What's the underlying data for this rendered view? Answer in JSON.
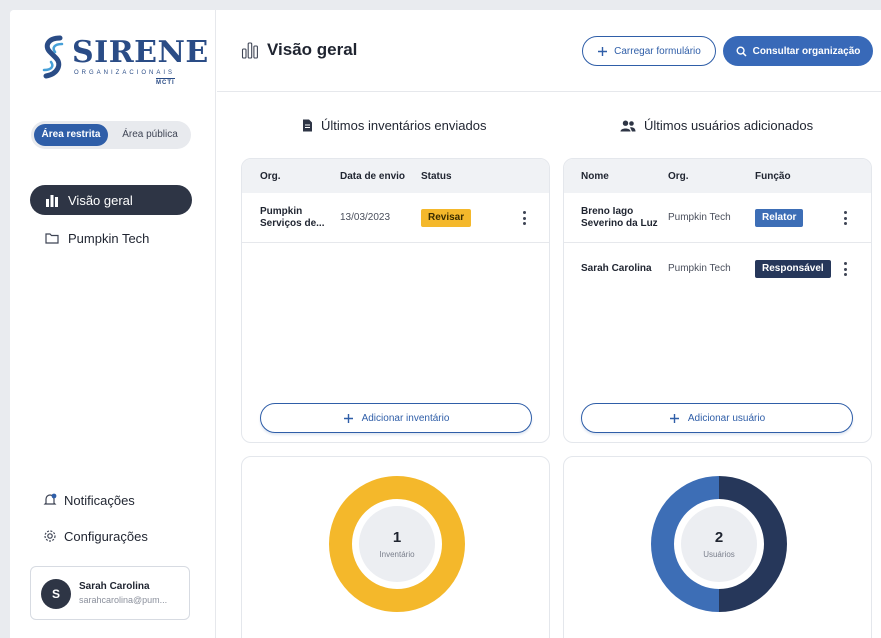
{
  "brand": {
    "title": "SIRENE",
    "subtitle": "ORGANIZACIONAIS",
    "tag": "MCTI"
  },
  "area_toggle": {
    "active": "Área restrita",
    "inactive": "Área pública"
  },
  "sidebar": {
    "nav": [
      {
        "label": "Visão geral",
        "icon": "bar-chart-icon",
        "active": true
      },
      {
        "label": "Pumpkin Tech",
        "icon": "folder-icon",
        "active": false
      }
    ],
    "notifications_label": "Notificações",
    "settings_label": "Configurações",
    "user": {
      "initial": "S",
      "name": "Sarah Carolina",
      "email": "sarahcarolina@pum..."
    }
  },
  "header": {
    "title": "Visão geral",
    "upload_label": "Carregar formulário",
    "search_label": "Consultar organização"
  },
  "inventories": {
    "title": "Últimos inventários enviados",
    "columns": [
      "Org.",
      "Data de envio",
      "Status"
    ],
    "rows": [
      {
        "org": "Pumpkin Serviços de...",
        "date": "13/03/2023",
        "status": "Revisar"
      }
    ],
    "add_label": "Adicionar inventário"
  },
  "users": {
    "title": "Últimos usuários adicionados",
    "columns": [
      "Nome",
      "Org.",
      "Função"
    ],
    "rows": [
      {
        "name": "Breno Iago Severino da Luz",
        "org": "Pumpkin Tech",
        "role": "Relator"
      },
      {
        "name": "Sarah Carolina",
        "org": "Pumpkin Tech",
        "role": "Responsável"
      }
    ],
    "add_label": "Adicionar usuário"
  },
  "stats": {
    "inventories": {
      "value": "1",
      "label": "Inventário",
      "color": "#f4b82b"
    },
    "users": {
      "value": "2",
      "label": "Usuários",
      "segments": [
        {
          "fraction": 0.5,
          "color": "#26375a"
        },
        {
          "fraction": 0.5,
          "color": "#3d6eb6"
        }
      ]
    }
  },
  "colors": {
    "accent": "#2f5ea8",
    "dark": "#2e3545",
    "warning": "#f4b82b"
  }
}
